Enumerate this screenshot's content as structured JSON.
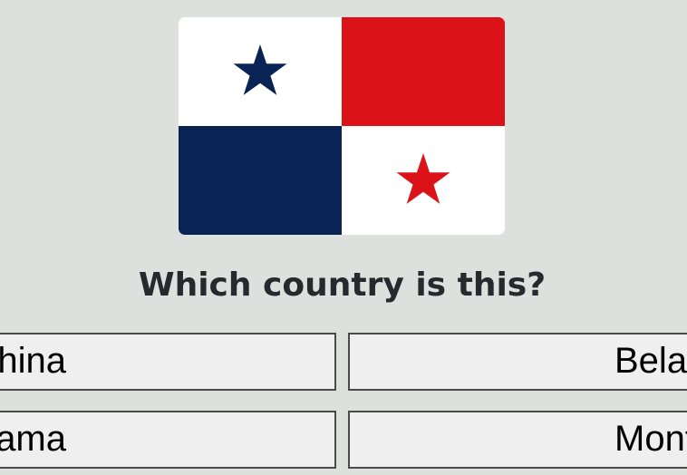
{
  "flag": {
    "country": "Panama",
    "colors": {
      "white": "#ffffff",
      "red": "#dc1219",
      "blue": "#0a2355"
    }
  },
  "question": "Which country is this?",
  "answers": [
    {
      "label": "China"
    },
    {
      "label": "Belarus"
    },
    {
      "label": "Panama"
    },
    {
      "label": "Montserrat"
    }
  ],
  "colors": {
    "background": "#dde1de",
    "button_background": "#efefef",
    "button_border": "#4a4a4a",
    "question_text": "#262a2f"
  }
}
